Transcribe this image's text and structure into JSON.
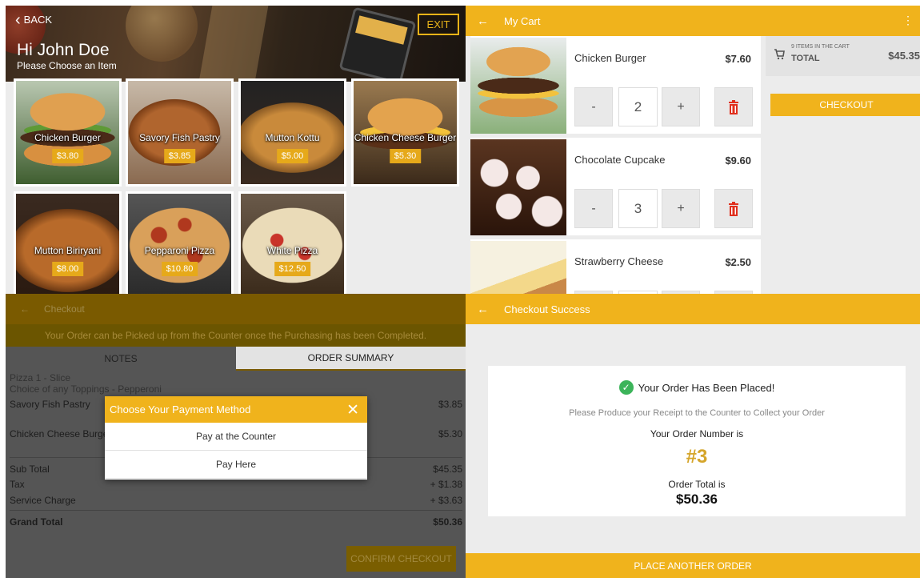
{
  "menu": {
    "back_label": "BACK",
    "exit_label": "EXIT",
    "greeting": "Hi John Doe",
    "prompt": "Please Choose an Item",
    "items": [
      {
        "name": "Chicken Burger",
        "price": "$3.80"
      },
      {
        "name": "Savory Fish Pastry",
        "price": "$3.85"
      },
      {
        "name": "Mutton Kottu",
        "price": "$5.00"
      },
      {
        "name": "Chicken Cheese Burger",
        "price": "$5.30"
      },
      {
        "name": "Mutton Biriryani",
        "price": "$8.00"
      },
      {
        "name": "Pepparoni Pizza",
        "price": "$10.80"
      },
      {
        "name": "White Pizza",
        "price": "$12.50"
      }
    ]
  },
  "cart": {
    "title": "My Cart",
    "back_icon": "←",
    "menu_icon": "⋮",
    "items": [
      {
        "name": "Chicken Burger",
        "price": "$7.60",
        "qty": "2"
      },
      {
        "name": "Chocolate Cupcake",
        "price": "$9.60",
        "qty": "3"
      },
      {
        "name": "Strawberry Cheese",
        "price": "$2.50",
        "qty": ""
      }
    ],
    "minus": "-",
    "plus": "+",
    "delete_icon": "🗑",
    "items_count": "9 ITEMS IN THE CART",
    "total_label": "TOTAL",
    "total": "$45.35",
    "checkout_label": "CHECKOUT"
  },
  "checkout": {
    "title": "Checkout",
    "back_icon": "←",
    "notice": "Your Order can be Picked up from the Counter once the Purchasing has been Completed.",
    "tabs": {
      "notes": "NOTES",
      "summary": "ORDER SUMMARY"
    },
    "pizza_line": "Pizza 1 - Slice",
    "toppings_line": "Choice of any Toppings - Pepperoni",
    "lines": [
      {
        "name": "Savory Fish Pastry",
        "price": "$3.85"
      },
      {
        "name": "Chicken Cheese Burger",
        "price": "$5.30"
      }
    ],
    "subtotal_label": "Sub Total",
    "subtotal": "$45.35",
    "tax_label": "Tax",
    "tax": "+ $1.38",
    "service_label": "Service Charge",
    "service": "+ $3.63",
    "grand_label": "Grand Total",
    "grand": "$50.36",
    "confirm_label": "CONFIRM CHECKOUT",
    "modal": {
      "title": "Choose Your Payment Method",
      "close": "✕",
      "options": [
        "Pay at the Counter",
        "Pay Here"
      ]
    }
  },
  "success": {
    "title": "Checkout Success",
    "back_icon": "←",
    "placed": "Your Order Has Been Placed!",
    "produce": "Please Produce your Receipt to the Counter to Collect your Order",
    "order_number_label": "Your Order Number is",
    "order_number": "#3",
    "order_total_label": "Order Total is",
    "order_total": "$50.36",
    "place_another": "PLACE ANOTHER ORDER"
  },
  "colors": {
    "accent": "#f0b31c",
    "price_badge": "#e6a91a",
    "delete": "#e0301e",
    "success": "#3cb45a"
  }
}
